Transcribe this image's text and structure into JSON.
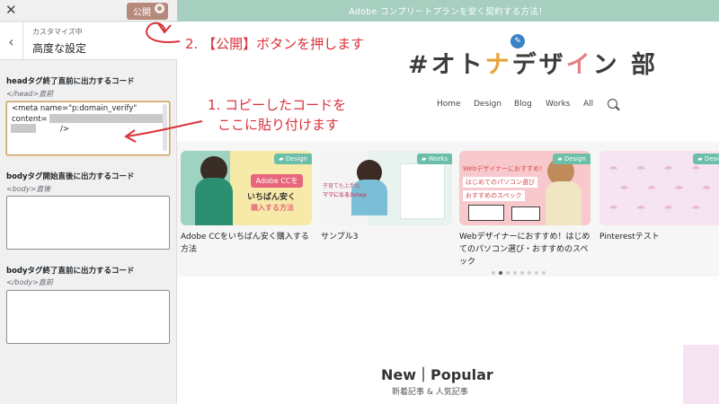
{
  "sidebar": {
    "close_icon": "close-icon",
    "publish_label": "公開",
    "publish_color": "#b58a7a",
    "header_subtitle": "カスタマイズ中",
    "header_title": "高度な設定",
    "fields": [
      {
        "label": "headタグ終了直前に出力するコード",
        "description": "</head>直前",
        "value": "<meta name=\"p:domain_verify\"\ncontent=\n                    />"
      },
      {
        "label": "bodyタグ開始直後に出力するコード",
        "description": "<body>直後",
        "value": ""
      },
      {
        "label": "bodyタグ終了直前に出力するコード",
        "description": "</body>直前",
        "value": ""
      }
    ]
  },
  "preview": {
    "topbar_text": "Adobe コンプリートプランを安く契約する方法！",
    "topbar_color": "#a6cfc0",
    "logo": {
      "hash": "#",
      "part1": "オト",
      "part2": "ナ",
      "part3": "デザ",
      "part4": "イ",
      "part5": "ン 部"
    },
    "nav": [
      "Home",
      "Design",
      "Blog",
      "Works",
      "All"
    ],
    "cards": [
      {
        "tag": "Design",
        "title": "Adobe CCをいちばん安く購入する方法",
        "thumb_text1": "Adobe CCを",
        "thumb_text2": "いちばん安く",
        "thumb_text3": "購入する方法"
      },
      {
        "tag": "Works",
        "title": "サンプル3",
        "thumb_text1": "子育ても上手な",
        "thumb_text2": "ママになる3step",
        "thumb_text3": ""
      },
      {
        "tag": "Design",
        "title": "Webデザイナーにおすすめ！はじめてのパソコン選び・おすすめのスペック",
        "thumb_text1": "Webデザイナーにおすすめ！",
        "thumb_text2": "はじめてのパソコン選び",
        "thumb_text3": "おすすめのスペック"
      },
      {
        "tag": "Design",
        "title": "Pinterestテスト",
        "thumb_text1": "",
        "thumb_text2": "",
        "thumb_text3": ""
      }
    ],
    "carousel_dots": 8,
    "carousel_active": 1,
    "section_title": "New｜Popular",
    "section_sub": "新着記事 & 人気記事"
  },
  "annotations": {
    "step2": "2. 【公開】ボタンを押します",
    "step1_line1": "1. コピーしたコードを",
    "step1_line2": "ここに貼り付けます",
    "color": "#d9323b"
  }
}
